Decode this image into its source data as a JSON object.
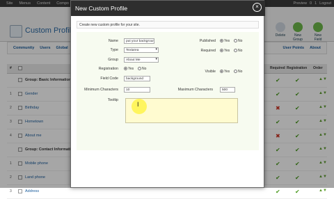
{
  "topbar": {
    "items": [
      "Site",
      "Menus",
      "Content",
      "Compo"
    ],
    "right": [
      "Preview",
      "0",
      "1",
      "Logout"
    ]
  },
  "header": {
    "title": "Custom Profiles",
    "buttons": [
      "Delete",
      "New Group",
      "New Field"
    ]
  },
  "subnav": {
    "left": [
      "Community",
      "Users",
      "Global"
    ],
    "right": [
      "User Points",
      "About"
    ]
  },
  "table": {
    "headers": [
      "#",
      "Required",
      "Registration",
      "Order"
    ],
    "rows": [
      {
        "n": "",
        "label": "Group: Basic Information",
        "group": true,
        "req": "✔",
        "reg": "✔"
      },
      {
        "n": "1",
        "label": "Gender",
        "req": "✔",
        "reg": "✔"
      },
      {
        "n": "2",
        "label": "Birthday",
        "req": "✖",
        "reg": "✔"
      },
      {
        "n": "3",
        "label": "Hometown",
        "req": "✔",
        "reg": "✔"
      },
      {
        "n": "4",
        "label": "About me",
        "req": "✖",
        "reg": "✔"
      },
      {
        "n": "",
        "label": "Group: Contact Information",
        "group": true,
        "req": "✔",
        "reg": "✔"
      },
      {
        "n": "1",
        "label": "Mobile phone",
        "req": "✔",
        "reg": "✔"
      },
      {
        "n": "2",
        "label": "Land phone",
        "req": "✔",
        "reg": "✔"
      },
      {
        "n": "3",
        "label": "Address",
        "req": "✔",
        "reg": "✔"
      }
    ]
  },
  "modal": {
    "title": "New Custom Profile",
    "close_icon": "close-icon",
    "description": "Create new custom profile for your site.",
    "labels": {
      "name": "Name",
      "type": "Type",
      "group": "Group",
      "registration": "Registration",
      "field_code": "Field Code",
      "min_chars": "Minimum Characters",
      "max_chars": "Maximum Characters",
      "tooltip": "Tooltip",
      "published": "Published",
      "required": "Required",
      "visible": "Visible"
    },
    "values": {
      "name": "put your background",
      "type": "Textarea",
      "group": "About Me",
      "field_code": "background",
      "min_chars": "10",
      "max_chars": "500",
      "tooltip": ""
    },
    "radio": {
      "yes": "Yes",
      "no": "No"
    }
  }
}
